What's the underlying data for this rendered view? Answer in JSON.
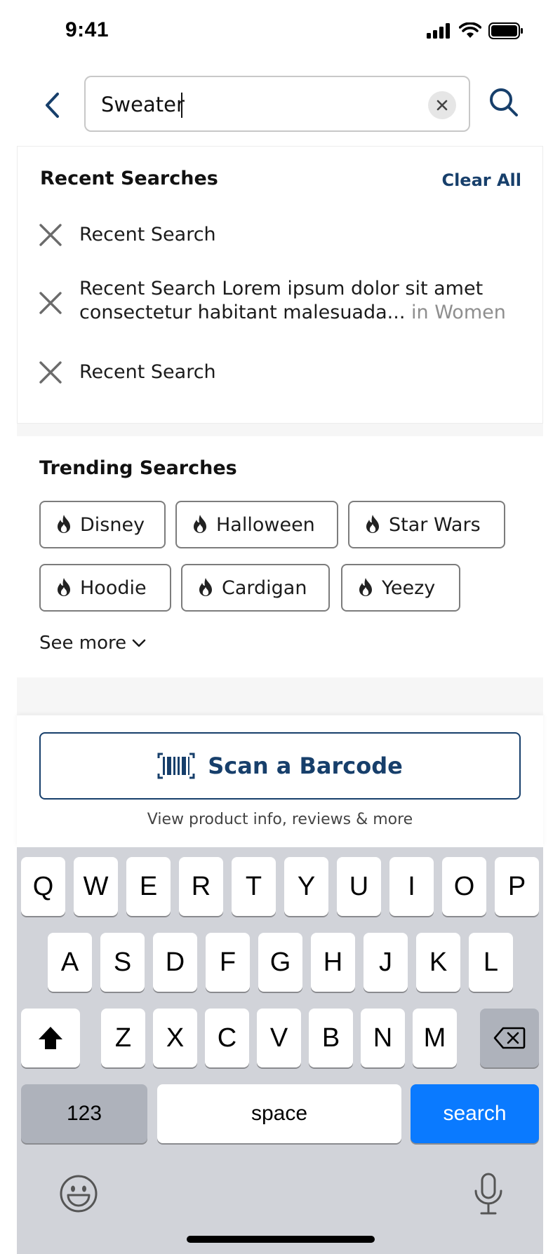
{
  "status_bar": {
    "time": "9:41"
  },
  "search": {
    "value": "Sweater"
  },
  "recent": {
    "title": "Recent Searches",
    "clear_all": "Clear All",
    "items": [
      {
        "text": "Recent Search",
        "suffix": ""
      },
      {
        "text": "Recent Search Lorem ipsum dolor sit amet",
        "text2": "consectetur habitant malesuada...",
        "suffix": "in Women"
      },
      {
        "text": "Recent Search",
        "suffix": ""
      }
    ]
  },
  "trending": {
    "title": "Trending Searches",
    "chips": [
      "Disney",
      "Halloween",
      "Star Wars",
      "Hoodie",
      "Cardigan",
      "Yeezy"
    ],
    "see_more": "See more"
  },
  "scan": {
    "label": "Scan a Barcode",
    "caption": "View product info, reviews & more"
  },
  "keyboard": {
    "row1": [
      "Q",
      "W",
      "E",
      "R",
      "T",
      "Y",
      "U",
      "I",
      "O",
      "P"
    ],
    "row2": [
      "A",
      "S",
      "D",
      "F",
      "G",
      "H",
      "J",
      "K",
      "L"
    ],
    "row3": [
      "Z",
      "X",
      "C",
      "V",
      "B",
      "N",
      "M"
    ],
    "numbers_key": "123",
    "space_key": "space",
    "search_key": "search"
  },
  "colors": {
    "brand_navy": "#173f6b",
    "keyboard_blue": "#0a7aff"
  },
  "icons": [
    "back-chevron-icon",
    "clear-input-icon",
    "search-icon",
    "remove-icon",
    "flame-icon",
    "chevron-down-icon",
    "barcode-icon",
    "shift-icon",
    "backspace-icon",
    "emoji-icon",
    "microphone-icon"
  ]
}
